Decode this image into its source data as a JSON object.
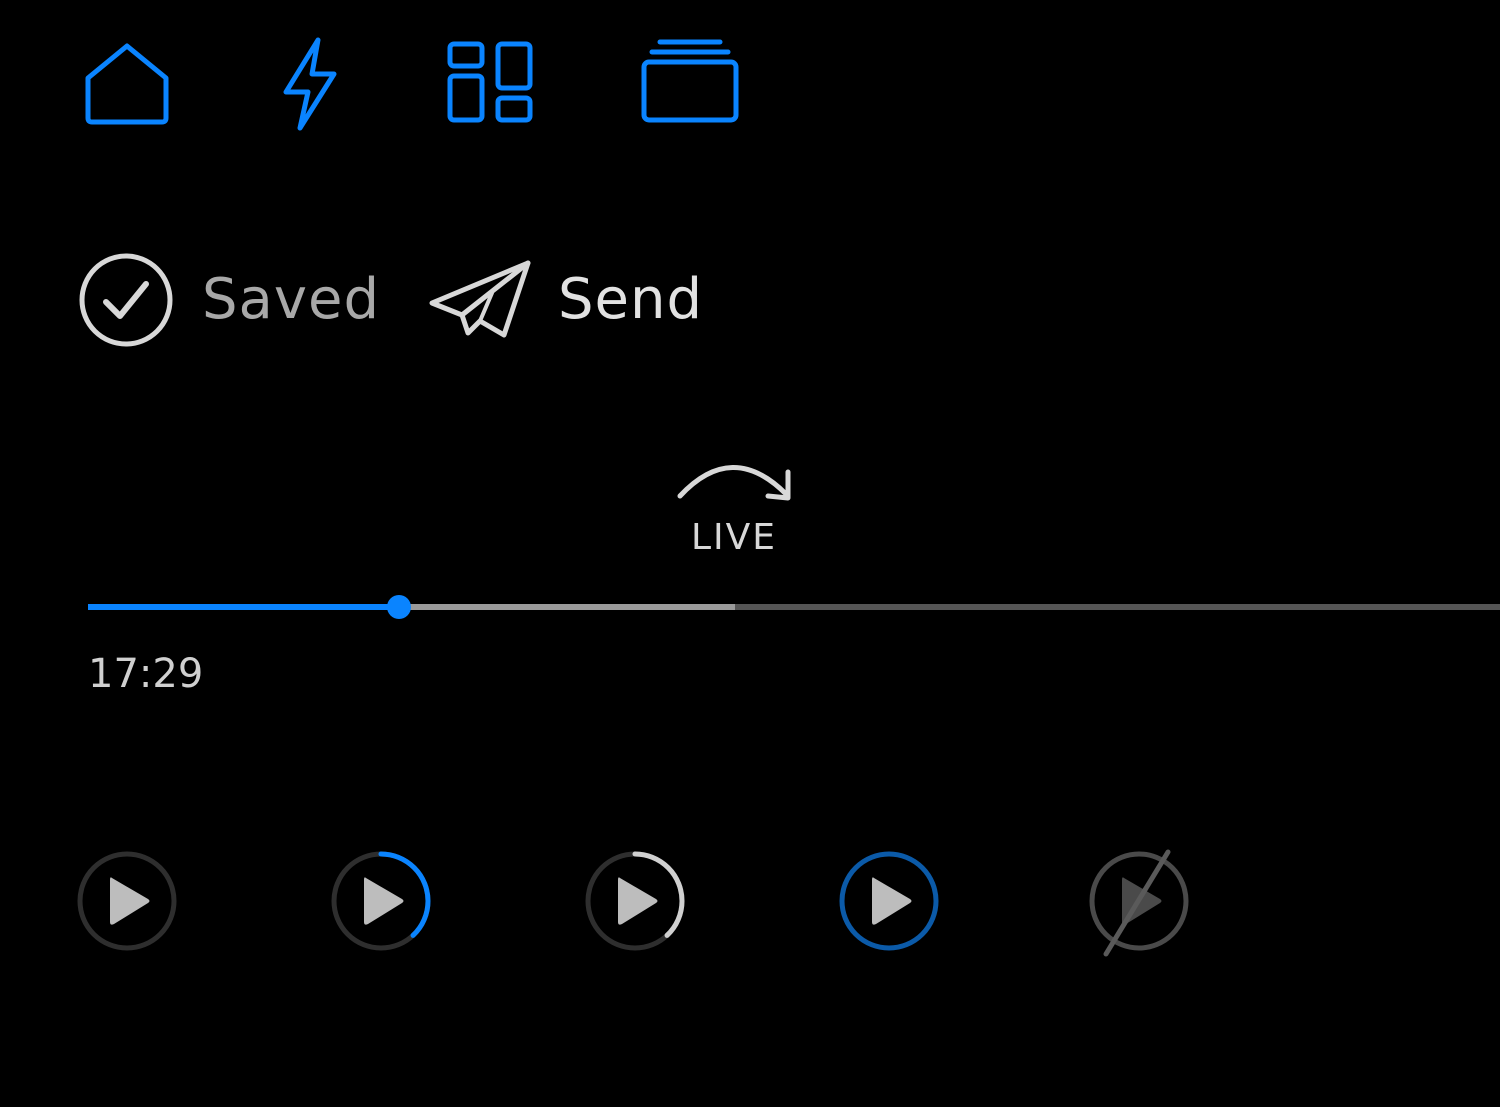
{
  "colors": {
    "accent": "#0a84ff",
    "icon_gray": "#d8d8d8",
    "track_buffered": "#9a9a9a",
    "track_remaining": "#555555",
    "ring_dark": "#2e2e2e",
    "ring_blue_dim": "#0b5aa8",
    "disabled_gray": "#5a5a5a"
  },
  "nav": {
    "icons": [
      "home-icon",
      "lightning-icon",
      "dashboard-grid-icon",
      "stacked-cards-icon"
    ]
  },
  "actions": {
    "saved": {
      "label": "Saved",
      "icon": "checkmark-circle-icon"
    },
    "send": {
      "label": "Send",
      "icon": "paper-plane-icon"
    }
  },
  "live": {
    "label": "LIVE",
    "icon": "curved-arrow-right-icon"
  },
  "timeline": {
    "played_fraction": 0.22,
    "buffered_fraction": 0.458,
    "current_time": "17:29"
  },
  "play_buttons": [
    {
      "state": "idle",
      "progress": 0
    },
    {
      "state": "progress-accent",
      "progress": 0.38
    },
    {
      "state": "progress-gray",
      "progress": 0.38
    },
    {
      "state": "active-ring",
      "progress": 1
    },
    {
      "state": "disabled",
      "progress": 0
    }
  ]
}
